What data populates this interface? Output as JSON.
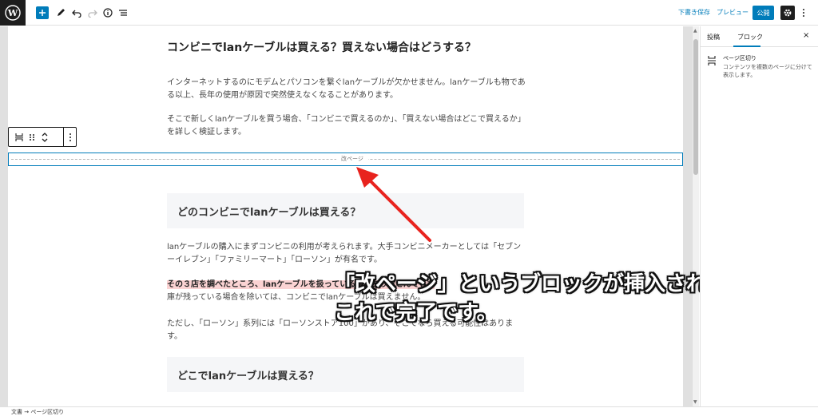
{
  "toolbar": {
    "save_draft": "下書き保存",
    "preview": "プレビュー",
    "publish": "公開"
  },
  "post": {
    "title": "コンビニでlanケーブルは買える？買えない場合はどうする？",
    "para1": "インターネットするのにモデムとパソコンを繋ぐlanケーブルが欠かせません。lanケーブルも物である以上、長年の使用が原因で突然使えなくなることがあります。",
    "para2": "そこで新しくlanケーブルを買う場合、「コンビニで買えるのか」、「買えない場合はどこで買えるか」を詳しく検証します。",
    "pagebreak_label": "改ページ",
    "heading1": "どのコンビニでlanケーブルは買える？",
    "para3": "lanケーブルの購入にまずコンビニの利用が考えられます。大手コンビニメーカーとしては「セブンーイレブン」「ファミリーマート」「ローソン」が有名です。",
    "para4_highlight": "その３店を調べたところ、lanケーブルを扱っている店はありませんでした",
    "para4_rest": "庫が残っている場合を除いては、コンビニでlanケーブルは買えません。",
    "para5": "ただし、「ローソン」系列には「ローソンストア100」があり、そこでなら買える可能性はあります。",
    "heading2": "どこでlanケーブルは買える？"
  },
  "annotation": {
    "line1": "「改ページ」というブロックが挿入されます。",
    "line2": "これで完了です。"
  },
  "sidebar": {
    "tab_post": "投稿",
    "tab_block": "ブロック",
    "close": "×",
    "block_title": "ページ区切り",
    "block_desc": "コンテンツを複数のページに分けて表示します。"
  },
  "statusbar": {
    "breadcrumb": "文書 → ページ区切り"
  },
  "colors": {
    "accent": "#007cba",
    "highlight": "#fbd3d3",
    "arrow": "#e8231e"
  }
}
